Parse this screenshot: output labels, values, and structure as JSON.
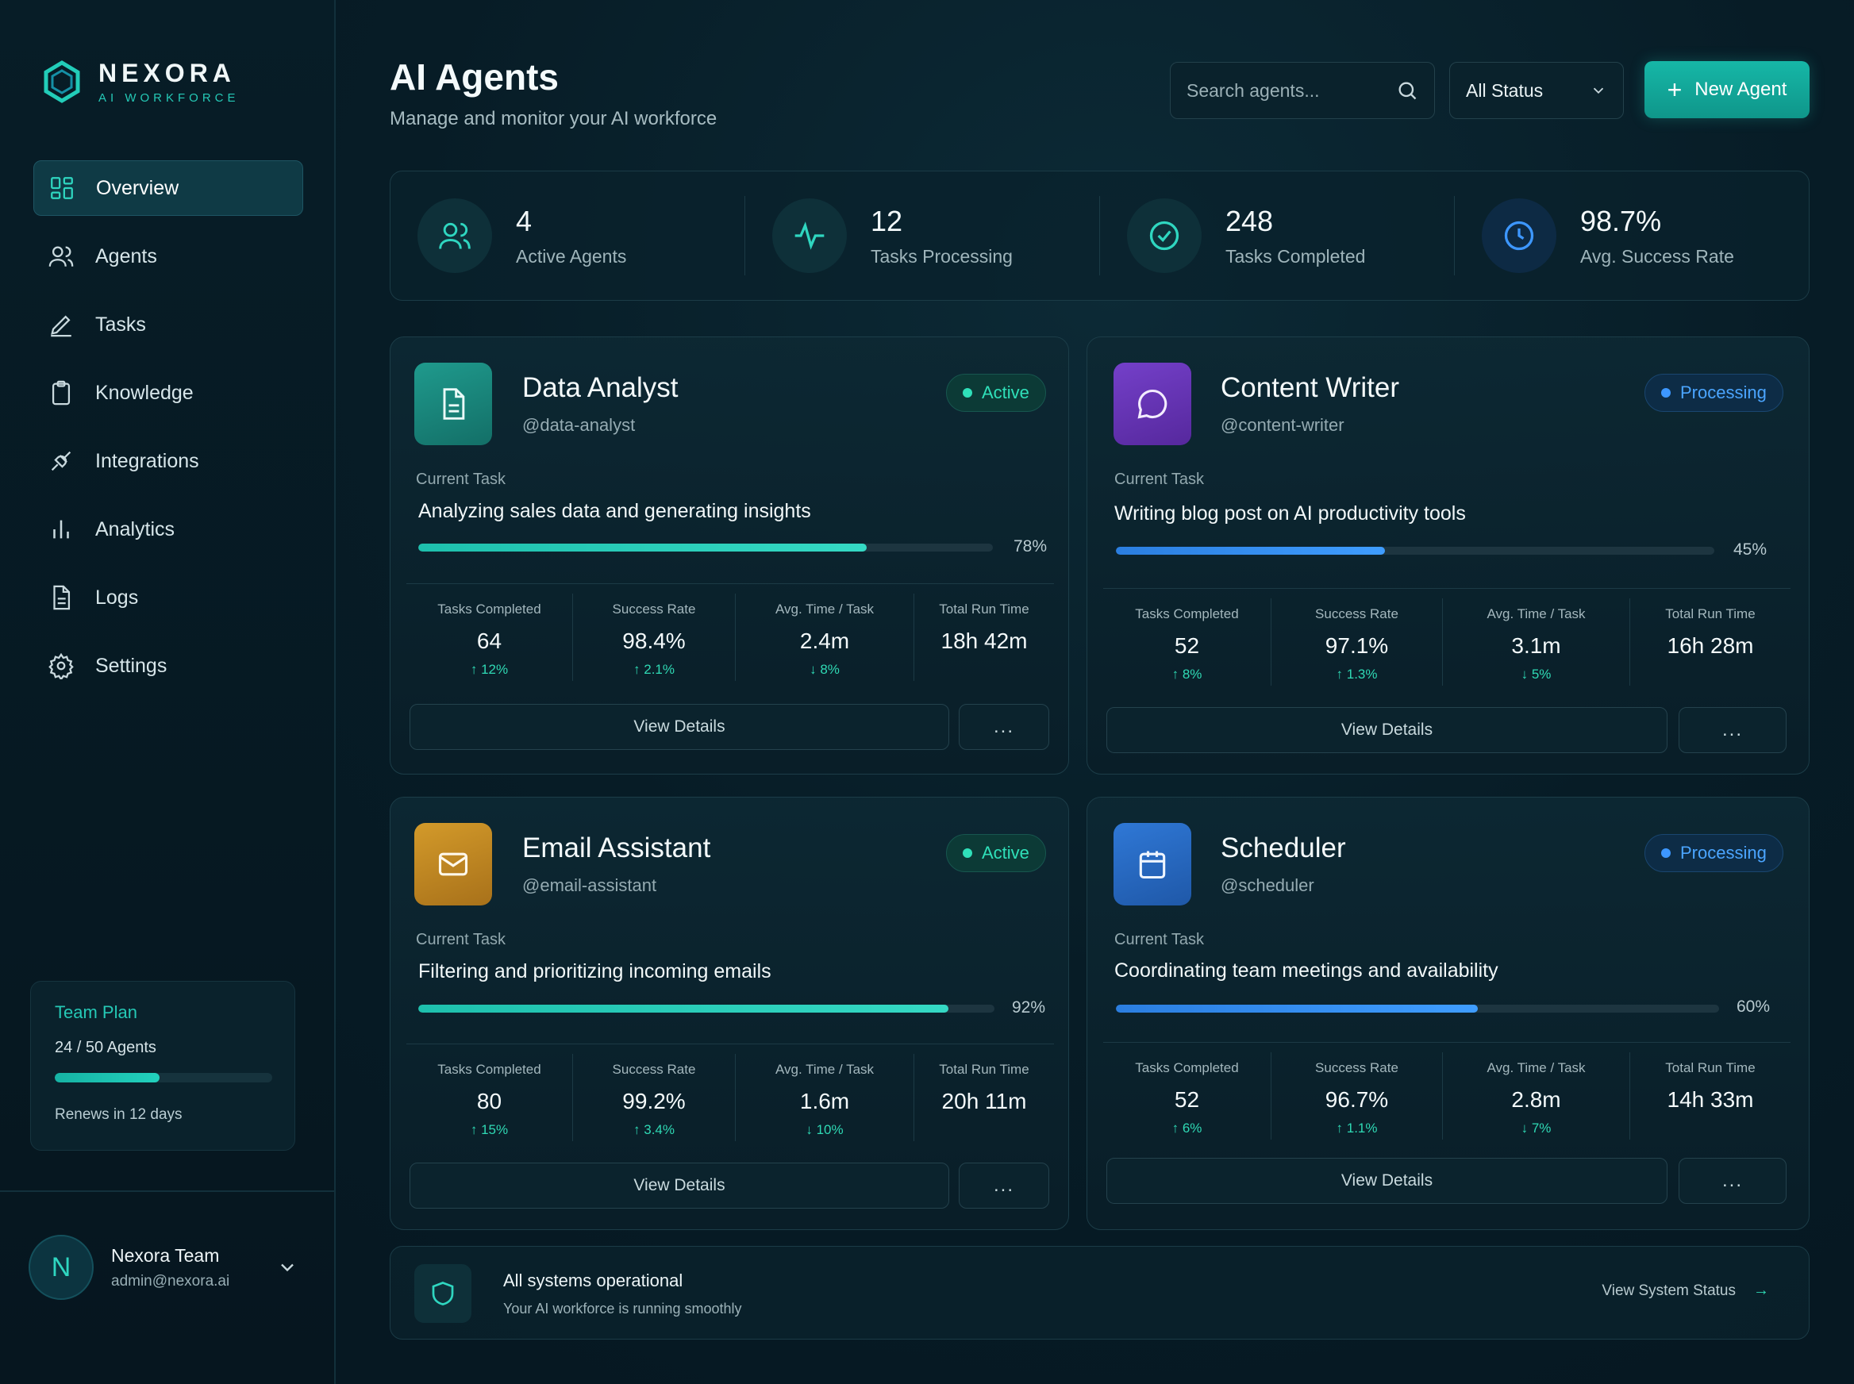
{
  "brand": {
    "name": "NEXORA",
    "tagline": "AI WORKFORCE"
  },
  "sidebar": {
    "items": [
      {
        "label": "Overview",
        "icon": "grid-icon",
        "active": true
      },
      {
        "label": "Agents",
        "icon": "users-icon"
      },
      {
        "label": "Tasks",
        "icon": "pencil-icon"
      },
      {
        "label": "Knowledge",
        "icon": "clipboard-icon"
      },
      {
        "label": "Integrations",
        "icon": "plug-icon"
      },
      {
        "label": "Analytics",
        "icon": "bar-chart-icon"
      },
      {
        "label": "Logs",
        "icon": "document-icon"
      },
      {
        "label": "Settings",
        "icon": "gear-icon"
      }
    ],
    "plan": {
      "title": "Team Plan",
      "count": "24 / 50 Agents",
      "used": 24,
      "total": 50,
      "renew": "Renews in 12 days"
    },
    "user": {
      "initial": "N",
      "name": "Nexora Team",
      "email": "admin@nexora.ai"
    }
  },
  "header": {
    "title": "AI Agents",
    "subtitle": "Manage and monitor your AI workforce",
    "search_placeholder": "Search agents...",
    "status_filter": "All Status",
    "new_agent_label": "New Agent"
  },
  "stats": [
    {
      "value": "4",
      "label": "Active Agents",
      "icon": "users-icon"
    },
    {
      "value": "12",
      "label": "Tasks Processing",
      "icon": "activity-icon"
    },
    {
      "value": "248",
      "label": "Tasks Completed",
      "icon": "check-circle-icon"
    },
    {
      "value": "98.7%",
      "label": "Avg. Success Rate",
      "icon": "clock-icon"
    }
  ],
  "agents": [
    {
      "name": "Data Analyst",
      "handle": "@data-analyst",
      "status": "Active",
      "icon": "document-icon",
      "task_label": "Current Task",
      "task": "Analyzing sales data and generating insights",
      "progress": 78,
      "progress_label": "78%",
      "metrics": [
        {
          "label": "Tasks Completed",
          "value": "64",
          "delta": "12%",
          "dir": "up"
        },
        {
          "label": "Success Rate",
          "value": "98.4%",
          "delta": "2.1%",
          "dir": "up"
        },
        {
          "label": "Avg. Time / Task",
          "value": "2.4m",
          "delta": "8%",
          "dir": "down"
        },
        {
          "label": "Total Run Time",
          "value": "18h 42m",
          "delta": "",
          "dir": ""
        }
      ]
    },
    {
      "name": "Content Writer",
      "handle": "@content-writer",
      "status": "Processing",
      "icon": "chat-bubble-icon",
      "task_label": "Current Task",
      "task": "Writing blog post on AI productivity tools",
      "progress": 45,
      "progress_label": "45%",
      "metrics": [
        {
          "label": "Tasks Completed",
          "value": "52",
          "delta": "8%",
          "dir": "up"
        },
        {
          "label": "Success Rate",
          "value": "97.1%",
          "delta": "1.3%",
          "dir": "up"
        },
        {
          "label": "Avg. Time / Task",
          "value": "3.1m",
          "delta": "5%",
          "dir": "down"
        },
        {
          "label": "Total Run Time",
          "value": "16h 28m",
          "delta": "",
          "dir": ""
        }
      ]
    },
    {
      "name": "Email Assistant",
      "handle": "@email-assistant",
      "status": "Active",
      "icon": "mail-icon",
      "task_label": "Current Task",
      "task": "Filtering and prioritizing incoming emails",
      "progress": 92,
      "progress_label": "92%",
      "metrics": [
        {
          "label": "Tasks Completed",
          "value": "80",
          "delta": "15%",
          "dir": "up"
        },
        {
          "label": "Success Rate",
          "value": "99.2%",
          "delta": "3.4%",
          "dir": "up"
        },
        {
          "label": "Avg. Time / Task",
          "value": "1.6m",
          "delta": "10%",
          "dir": "down"
        },
        {
          "label": "Total Run Time",
          "value": "20h 11m",
          "delta": "",
          "dir": ""
        }
      ]
    },
    {
      "name": "Scheduler",
      "handle": "@scheduler",
      "status": "Processing",
      "icon": "calendar-icon",
      "task_label": "Current Task",
      "task": "Coordinating team meetings and availability",
      "progress": 60,
      "progress_label": "60%",
      "metrics": [
        {
          "label": "Tasks Completed",
          "value": "52",
          "delta": "6%",
          "dir": "up"
        },
        {
          "label": "Success Rate",
          "value": "96.7%",
          "delta": "1.1%",
          "dir": "up"
        },
        {
          "label": "Avg. Time / Task",
          "value": "2.8m",
          "delta": "7%",
          "dir": "down"
        },
        {
          "label": "Total Run Time",
          "value": "14h 33m",
          "delta": "",
          "dir": ""
        }
      ]
    }
  ],
  "card_actions": {
    "view": "View Details",
    "more": "..."
  },
  "system": {
    "title": "All systems operational",
    "subtitle": "Your AI workforce is running smoothly",
    "link": "View System Status"
  },
  "colors": {
    "accent": "#20c9b4",
    "active": "#2fe0b9",
    "processing": "#3d97ff",
    "bg": "#061822"
  }
}
